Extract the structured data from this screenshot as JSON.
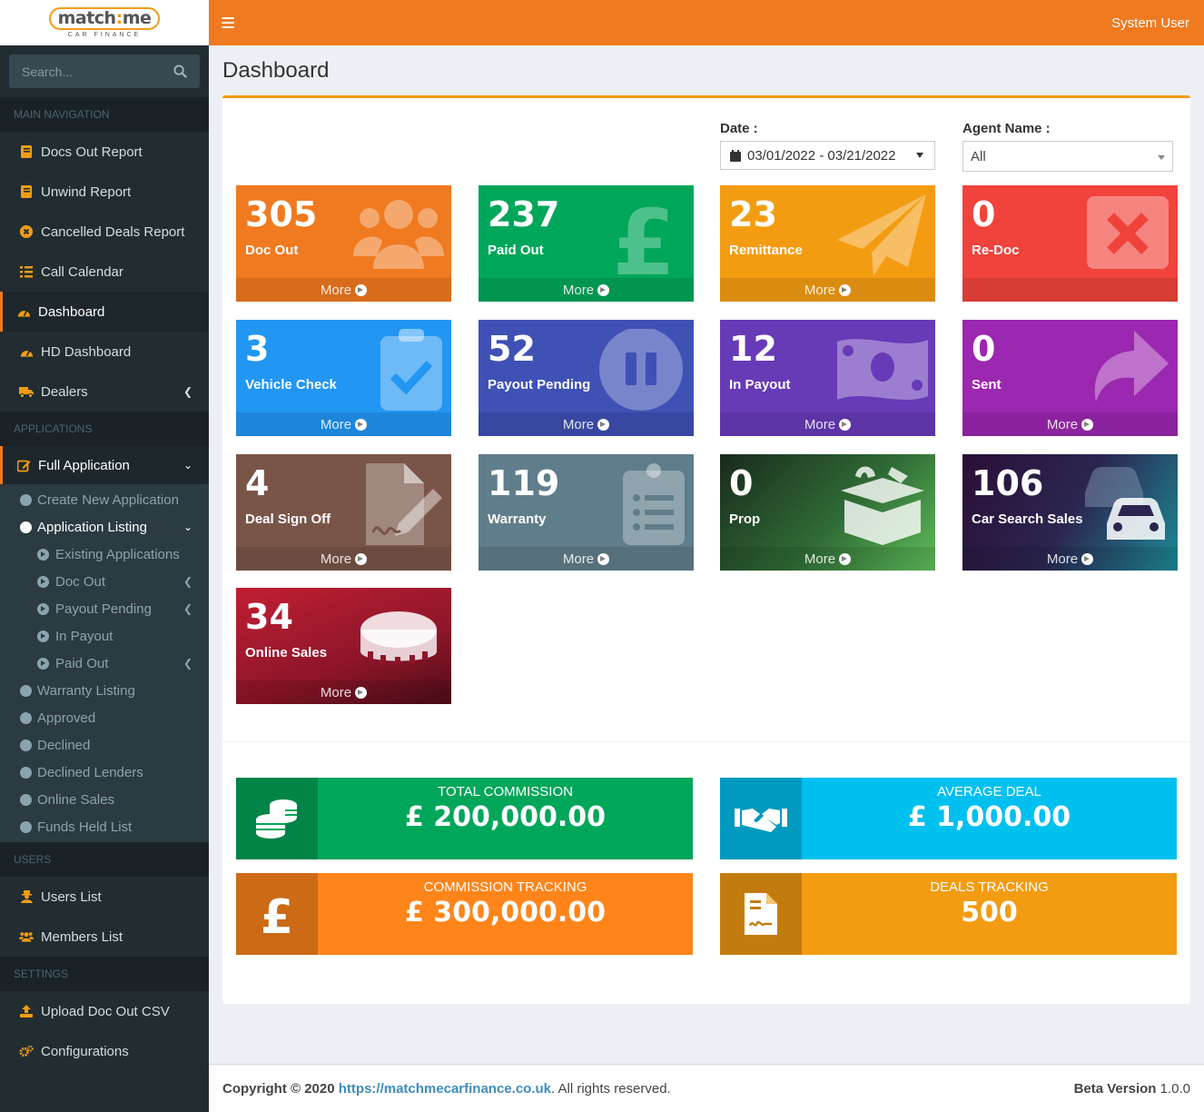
{
  "logo": {
    "brand_left": "match",
    "brand_colon": ":",
    "brand_right": "me",
    "tagline": "CAR FINANCE"
  },
  "search": {
    "placeholder": "Search..."
  },
  "nav": {
    "main_header": "MAIN NAVIGATION",
    "main_items": [
      {
        "label": "Docs Out Report",
        "icon": "book-icon"
      },
      {
        "label": "Unwind Report",
        "icon": "book-icon"
      },
      {
        "label": "Cancelled Deals Report",
        "icon": "times-circle-icon"
      },
      {
        "label": "Call Calendar",
        "icon": "list-icon"
      },
      {
        "label": "Dashboard",
        "icon": "dashboard-icon"
      },
      {
        "label": "HD Dashboard",
        "icon": "dashboard-icon"
      },
      {
        "label": "Dealers",
        "icon": "truck-icon"
      }
    ],
    "applications_header": "APPLICATIONS",
    "full_application": "Full Application",
    "sub_items": {
      "create": "Create New Application",
      "listing": "Application Listing",
      "existing": "Existing Applications",
      "doc_out": "Doc Out",
      "payout_pending": "Payout Pending",
      "in_payout": "In Payout",
      "paid_out": "Paid Out",
      "warranty": "Warranty Listing",
      "approved": "Approved",
      "declined": "Declined",
      "declined_lenders": "Declined Lenders",
      "online_sales": "Online Sales",
      "funds_held": "Funds Held List"
    },
    "users_header": "USERS",
    "users_items": [
      "Users List",
      "Members List"
    ],
    "settings_header": "SETTINGS",
    "settings_items": [
      "Upload Doc Out CSV",
      "Configurations"
    ]
  },
  "topbar": {
    "user": "System User"
  },
  "page": {
    "title": "Dashboard"
  },
  "filters": {
    "date_label": "Date :",
    "date_value": "03/01/2022 - 03/21/2022",
    "agent_label": "Agent Name :",
    "agent_value": "All"
  },
  "tiles": [
    {
      "value": "305",
      "label": "Doc Out",
      "more": "More",
      "color": "#f07a20",
      "icon": "users-icon"
    },
    {
      "value": "237",
      "label": "Paid Out",
      "more": "More",
      "color": "#00a65a",
      "icon": "pound-icon"
    },
    {
      "value": "23",
      "label": "Remittance",
      "more": "More",
      "color": "#f39c12",
      "icon": "paper-plane-icon"
    },
    {
      "value": "0",
      "label": "Re-Doc",
      "more": "",
      "color": "#f0433b",
      "icon": "close-box-icon"
    },
    {
      "value": "3",
      "label": "Vehicle Check",
      "more": "More",
      "color": "#2196f3",
      "icon": "clipboard-check-icon"
    },
    {
      "value": "52",
      "label": "Payout Pending",
      "more": "More",
      "color": "#3f51b5",
      "icon": "pause-circle-icon"
    },
    {
      "value": "12",
      "label": "In Payout",
      "more": "More",
      "color": "#673ab7",
      "icon": "money-bill-icon"
    },
    {
      "value": "0",
      "label": "Sent",
      "more": "More",
      "color": "#9c27b0",
      "icon": "share-icon"
    },
    {
      "value": "4",
      "label": "Deal Sign Off",
      "more": "More",
      "color": "#795548",
      "icon": "file-signature-icon"
    },
    {
      "value": "119",
      "label": "Warranty",
      "more": "More",
      "color": "#607d8b",
      "icon": "clipboard-list-icon"
    },
    {
      "value": "0",
      "label": "Prop",
      "more": "More",
      "color": "#1d3a23",
      "icon": "box-open-icon"
    },
    {
      "value": "106",
      "label": "Car Search Sales",
      "more": "More",
      "color": "#2e1538",
      "icon": "cars-icon"
    },
    {
      "value": "34",
      "label": "Online Sales",
      "more": "More",
      "color": "#a3182c",
      "icon": "coin-icon"
    }
  ],
  "stats": [
    {
      "title": "TOTAL COMMISSION",
      "value": "£ 200,000.00",
      "color": "#00a65a",
      "icon": "coins-icon"
    },
    {
      "title": "AVERAGE DEAL",
      "value": "£ 1,000.00",
      "color": "#00c0ef",
      "icon": "handshake-icon"
    },
    {
      "title": "COMMISSION TRACKING",
      "value": "£ 300,000.00",
      "color": "#ff851b",
      "icon": "pound-icon"
    },
    {
      "title": "DEALS TRACKING",
      "value": "500",
      "color": "#f39c12",
      "icon": "file-contract-icon"
    }
  ],
  "footer": {
    "copyright": "Copyright © 2020",
    "link": "https://matchmecarfinance.co.uk",
    "rights": ". All rights reserved.",
    "version_label": "Beta Version",
    "version": "1.0.0"
  }
}
